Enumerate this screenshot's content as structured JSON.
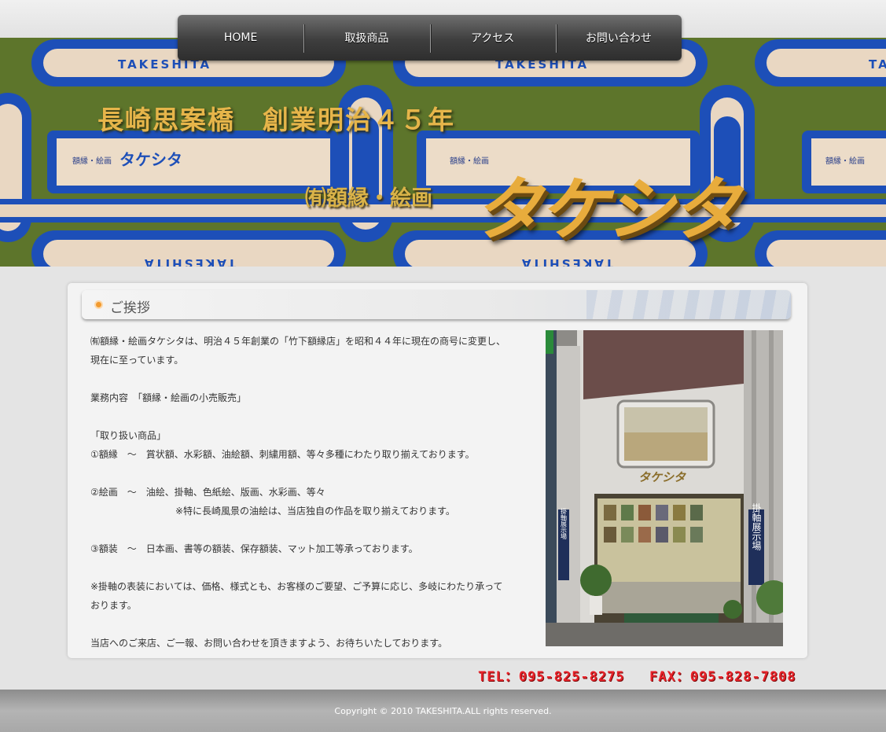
{
  "nav": {
    "items": [
      {
        "label": "HOME"
      },
      {
        "label": "取扱商品"
      },
      {
        "label": "アクセス"
      },
      {
        "label": "お問い合わせ"
      }
    ]
  },
  "banner": {
    "repeat_text": "TAKESHITA",
    "tagline": "長崎思案橋　創業明治４５年",
    "company": "㈲額縁・絵画",
    "logo_text": "タケシタ",
    "sign_label": "額縁・絵画",
    "sign_logo": "タケシタ"
  },
  "section": {
    "title": "ご挨拶",
    "paragraphs": [
      "㈲額縁・絵画タケシタは、明治４５年創業の「竹下額縁店」を昭和４４年に現在の商号に変更し、",
      "現在に至っています。",
      "",
      "業務内容　「額縁・絵画の小売販売」",
      "",
      "「取り扱い商品」",
      "①額縁　〜　賞状額、水彩額、油絵額、刺繍用額、等々多種にわたり取り揃えております。",
      "",
      "②絵画　〜　油絵、掛軸、色紙絵、版画、水彩画、等々",
      "　　　　　　　　　※特に長崎風景の油絵は、当店独自の作品を取り揃えております。",
      "",
      "③額装　〜　日本画、書等の額装、保存額装、マット加工等承っております。",
      "",
      "※掛軸の表装においては、価格、様式とも、お客様のご要望、ご予算に応じ、多岐にわたり承って",
      "おります。",
      "",
      "当店へのご来店、ご一報、お問い合わせを頂きますよう、お待ちいたしております。"
    ]
  },
  "photo": {
    "shop_sign": "タケシタ",
    "banner_right": "掛軸展示場",
    "banner_left": "掛軸展示場"
  },
  "contact": {
    "tel": "TEL：095-825-8275",
    "fax": "FAX：095-828-7808"
  },
  "footer": {
    "copyright": "Copyright © 2010 TAKESHITA.ALL rights reserved."
  }
}
